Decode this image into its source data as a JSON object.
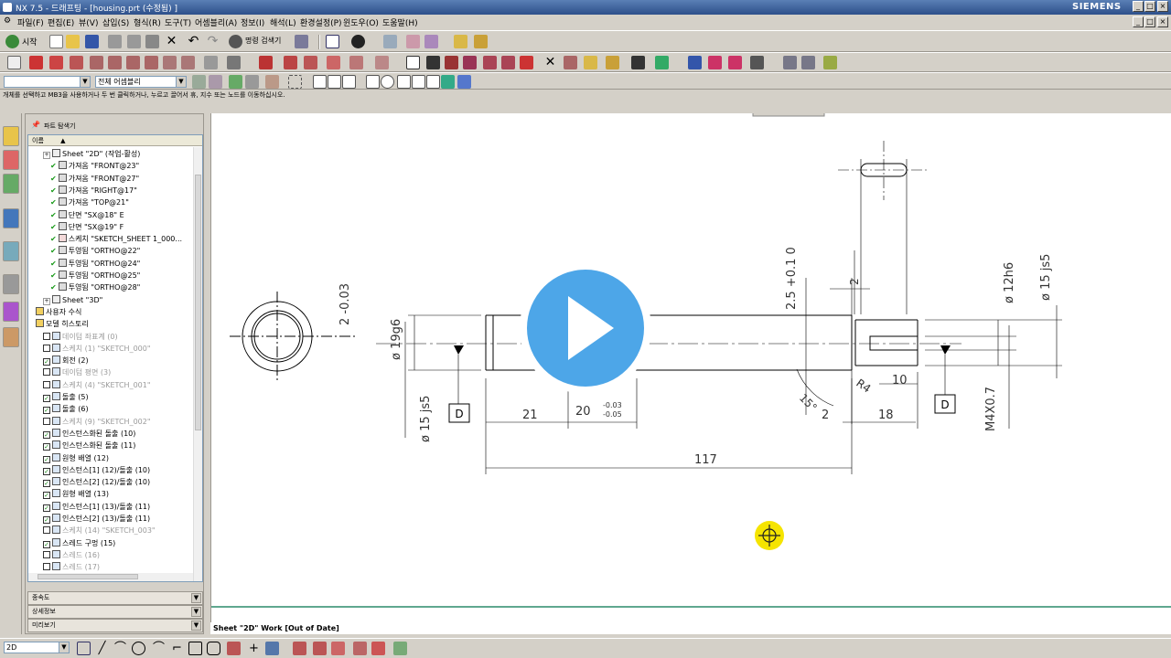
{
  "window": {
    "title": "NX 7.5 - 드래프팅 - [housing.prt (수정됨) ]",
    "brand": "SIEMENS",
    "controls": [
      "_",
      "□",
      "×"
    ]
  },
  "menu": [
    "파일(F)",
    "편집(E)",
    "뷰(V)",
    "삽입(S)",
    "형식(R)",
    "도구(T)",
    "어셈블리(A)",
    "정보(I)",
    "해석(L)",
    "환경설정(P)",
    "윈도우(O)",
    "도움말(H)"
  ],
  "toolbar1": {
    "start_label": "시작",
    "command_finder_label": "명령 검색기"
  },
  "selection_bar": {
    "filter_value": "",
    "scope_value": "전체 어셈블리"
  },
  "cue_line": "개체를 선택하고 MB3을 사용하거나 두 번 클릭하거나, 누르고 끌어서 휴, 지수 또는 노드를 이동하십시오.",
  "navigator": {
    "title": "파트 탐색기",
    "column_header": "이름",
    "rows": [
      {
        "text": "Sheet \"2D\" (작업-활성)",
        "indent": 2,
        "grey": false,
        "type": "sheet"
      },
      {
        "text": "가져옴 \"FRONT@23\"",
        "indent": 3,
        "grey": false,
        "type": "view"
      },
      {
        "text": "가져옴 \"FRONT@27\"",
        "indent": 3,
        "grey": false,
        "type": "view"
      },
      {
        "text": "가져옴 \"RIGHT@17\"",
        "indent": 3,
        "grey": false,
        "type": "view"
      },
      {
        "text": "가져옴 \"TOP@21\"",
        "indent": 3,
        "grey": false,
        "type": "view"
      },
      {
        "text": "단면 \"SX@18\" E",
        "indent": 3,
        "grey": false,
        "type": "view"
      },
      {
        "text": "단면 \"SX@19\" F",
        "indent": 3,
        "grey": false,
        "type": "view"
      },
      {
        "text": "스케치 \"SKETCH_SHEET 1_000...",
        "indent": 3,
        "grey": false,
        "type": "sketch"
      },
      {
        "text": "투영됨 \"ORTHO@22\"",
        "indent": 3,
        "grey": false,
        "type": "view"
      },
      {
        "text": "투영됨 \"ORTHO@24\"",
        "indent": 3,
        "grey": false,
        "type": "view"
      },
      {
        "text": "투영됨 \"ORTHO@25\"",
        "indent": 3,
        "grey": false,
        "type": "view"
      },
      {
        "text": "투영됨 \"ORTHO@28\"",
        "indent": 3,
        "grey": false,
        "type": "view"
      },
      {
        "text": "Sheet \"3D\"",
        "indent": 2,
        "grey": false,
        "type": "sheet"
      },
      {
        "text": "사용자 수식",
        "indent": 1,
        "grey": false,
        "type": "folder"
      },
      {
        "text": "모델 히스토리",
        "indent": 1,
        "grey": false,
        "type": "folder"
      },
      {
        "text": "데이텀 좌표계 (0)",
        "indent": 2,
        "grey": true,
        "type": "feature"
      },
      {
        "text": "스케치 (1) \"SKETCH_000\"",
        "indent": 2,
        "grey": true,
        "type": "feature"
      },
      {
        "text": "회전 (2)",
        "indent": 2,
        "grey": false,
        "type": "feature"
      },
      {
        "text": "데이텀 평면 (3)",
        "indent": 2,
        "grey": true,
        "type": "feature"
      },
      {
        "text": "스케치 (4) \"SKETCH_001\"",
        "indent": 2,
        "grey": true,
        "type": "feature"
      },
      {
        "text": "돌출 (5)",
        "indent": 2,
        "grey": false,
        "type": "feature"
      },
      {
        "text": "돌출 (6)",
        "indent": 2,
        "grey": false,
        "type": "feature"
      },
      {
        "text": "스케치 (9) \"SKETCH_002\"",
        "indent": 2,
        "grey": true,
        "type": "feature"
      },
      {
        "text": "인스턴스화된 돌출 (10)",
        "indent": 2,
        "grey": false,
        "type": "feature"
      },
      {
        "text": "인스턴스화된 돌출 (11)",
        "indent": 2,
        "grey": false,
        "type": "feature"
      },
      {
        "text": "원형 배열 (12)",
        "indent": 2,
        "grey": false,
        "type": "feature"
      },
      {
        "text": "인스턴스[1] (12)/돌출 (10)",
        "indent": 2,
        "grey": false,
        "type": "feature"
      },
      {
        "text": "인스턴스[2] (12)/돌출 (10)",
        "indent": 2,
        "grey": false,
        "type": "feature"
      },
      {
        "text": "원형 배열 (13)",
        "indent": 2,
        "grey": false,
        "type": "feature"
      },
      {
        "text": "인스턴스[1] (13)/돌출 (11)",
        "indent": 2,
        "grey": false,
        "type": "feature"
      },
      {
        "text": "인스턴스[2] (13)/돌출 (11)",
        "indent": 2,
        "grey": false,
        "type": "feature"
      },
      {
        "text": "스케치 (14) \"SKETCH_003\"",
        "indent": 2,
        "grey": true,
        "type": "feature"
      },
      {
        "text": "스레드 구멍 (15)",
        "indent": 2,
        "grey": false,
        "type": "feature"
      },
      {
        "text": "스레드 (16)",
        "indent": 2,
        "grey": true,
        "type": "feature"
      },
      {
        "text": "스레드 (17)",
        "indent": 2,
        "grey": true,
        "type": "feature"
      }
    ],
    "panels": [
      "종속도",
      "상세정보",
      "미리보기"
    ]
  },
  "drawing": {
    "dims": {
      "d_left_tol": "2 -0.03",
      "d_19": "ø 19g6",
      "d_15_left": "ø 15 js5",
      "d_21": "21",
      "d_20": "20",
      "d_20_tol_top": "-0.03",
      "d_20_tol_bot": "-0.05",
      "d_117": "117",
      "d_25": "2.5 +0.1 0",
      "d_12": "ø 12h6",
      "d_15_right": "ø 15 js5",
      "d_r4": "R4",
      "d_15deg": "15°",
      "d_10": "10",
      "d_2": "2",
      "d_18": "18",
      "d_m4": "M4X0.7",
      "datum_left": "D",
      "datum_right": "D",
      "slot_small": "2"
    },
    "status": "Sheet \"2D\" Work [Out of Date]"
  },
  "bottom_bar": {
    "layer_value": "2D"
  },
  "colors": {
    "play_button": "#4da6e8",
    "cursor_highlight": "#f5e400",
    "border_line": "#2a8a6a"
  }
}
